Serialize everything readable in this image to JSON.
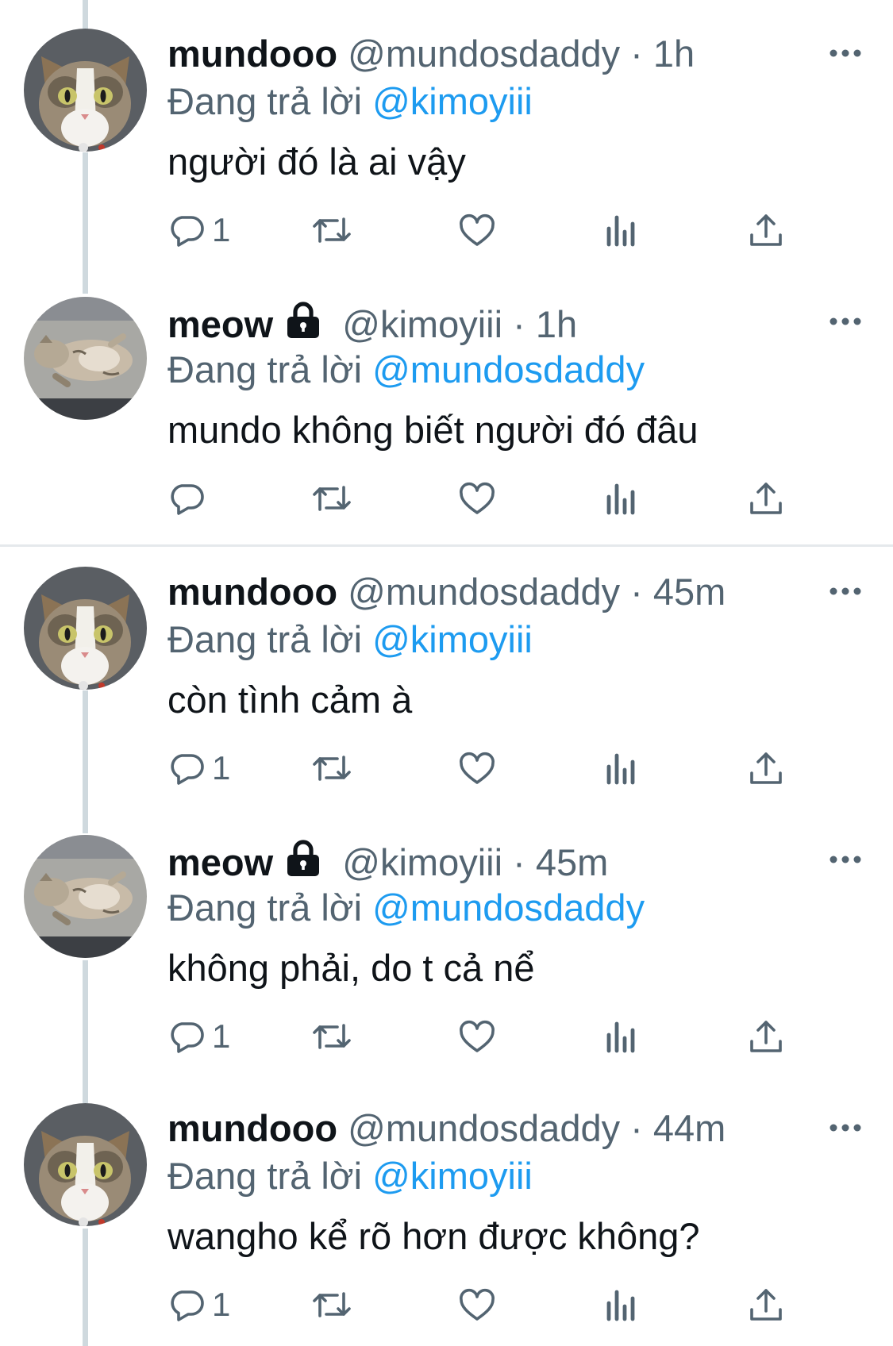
{
  "tweets": [
    {
      "avatar": "cat-face-avatar",
      "name": "mundooo",
      "locked": false,
      "handle": "@mundosdaddy",
      "separator": "·",
      "time": "1h",
      "replying_prefix": "Đang trả lời",
      "replying_to": "@kimoyiii",
      "text": "người đó là ai vậy",
      "reply_count": "1"
    },
    {
      "avatar": "sleeping-cat-avatar",
      "name": "meow",
      "locked": true,
      "handle": "@kimoyiii",
      "separator": "·",
      "time": "1h",
      "replying_prefix": "Đang trả lời",
      "replying_to": "@mundosdaddy",
      "text": "mundo không biết người đó đâu",
      "reply_count": ""
    },
    {
      "avatar": "cat-face-avatar",
      "name": "mundooo",
      "locked": false,
      "handle": "@mundosdaddy",
      "separator": "·",
      "time": "45m",
      "replying_prefix": "Đang trả lời",
      "replying_to": "@kimoyiii",
      "text": "còn tình cảm à",
      "reply_count": "1"
    },
    {
      "avatar": "sleeping-cat-avatar",
      "name": "meow",
      "locked": true,
      "handle": "@kimoyiii",
      "separator": "·",
      "time": "45m",
      "replying_prefix": "Đang trả lời",
      "replying_to": "@mundosdaddy",
      "text": "không phải, do t cả nể",
      "reply_count": "1"
    },
    {
      "avatar": "cat-face-avatar",
      "name": "mundooo",
      "locked": false,
      "handle": "@mundosdaddy",
      "separator": "·",
      "time": "44m",
      "replying_prefix": "Đang trả lời",
      "replying_to": "@kimoyiii",
      "text": "wangho kể rõ hơn được không?",
      "reply_count": "1"
    }
  ],
  "icons": {
    "reply": "reply-bubble-icon",
    "retweet": "retweet-icon",
    "like": "heart-icon",
    "views": "views-chart-icon",
    "share": "share-upload-icon",
    "more": "more-dots-icon",
    "lock": "lock-icon"
  },
  "colors": {
    "mention": "#1d9bf0",
    "secondary_text": "#536471",
    "thread_line": "#cfd9de"
  }
}
